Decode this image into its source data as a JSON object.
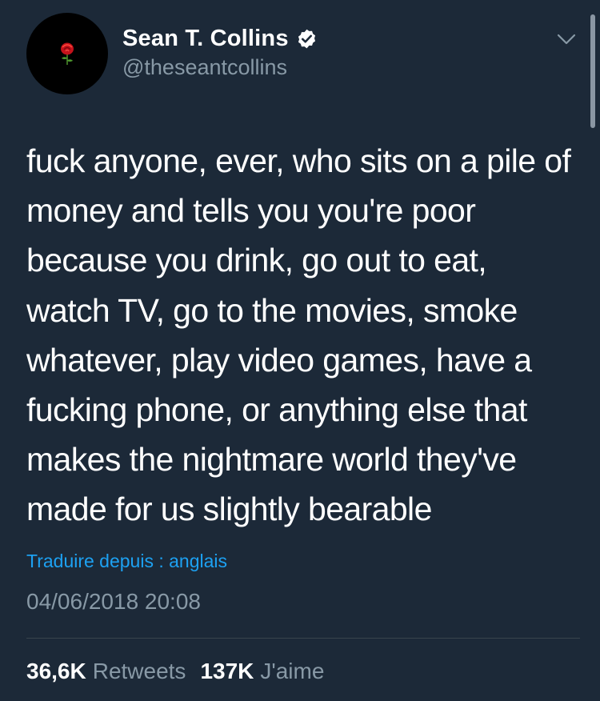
{
  "author": {
    "display_name": "Sean T. Collins",
    "handle": "@theseantcollins",
    "avatar_icon": "rose-icon",
    "verified": true
  },
  "tweet": {
    "text": "fuck anyone, ever, who sits on a pile of\nmoney and tells you you're poor\nbecause you drink, go out to eat,\nwatch TV, go to the movies, smoke\nwhatever, play video games, have a\nfucking phone, or anything else that\nmakes the nightmare world they've\nmade for us slightly bearable",
    "translate_label": "Traduire depuis : anglais",
    "timestamp": "04/06/2018 20:08"
  },
  "stats": {
    "retweets_count": "36,6K",
    "retweets_label": "Retweets",
    "likes_count": "137K",
    "likes_label": "J'aime"
  },
  "colors": {
    "background": "#1c2938",
    "secondary_text": "#8899a6",
    "link": "#1da1f2",
    "divider": "#38444d"
  }
}
